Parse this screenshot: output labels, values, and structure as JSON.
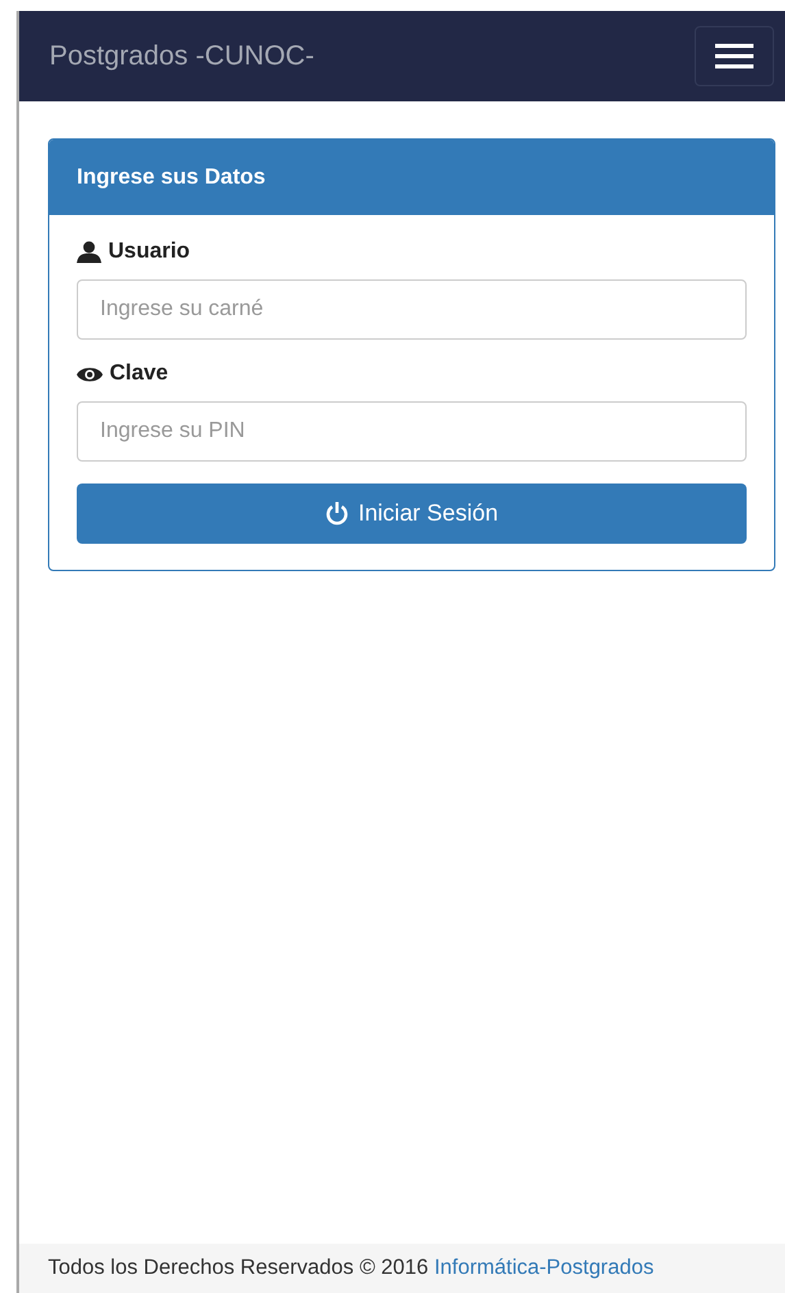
{
  "navbar": {
    "brand": "Postgrados -CUNOC-"
  },
  "panel": {
    "title": "Ingrese sus Datos",
    "fields": [
      {
        "kind": "user",
        "label": "Usuario",
        "placeholder": "Ingrese su carné"
      },
      {
        "kind": "eye",
        "label": "Clave",
        "placeholder": "Ingrese su PIN"
      }
    ],
    "button": "Iniciar Sesión"
  },
  "footer": {
    "text": "Todos los Derechos Reservados © 2016",
    "link": "Informática-Postgrados"
  }
}
